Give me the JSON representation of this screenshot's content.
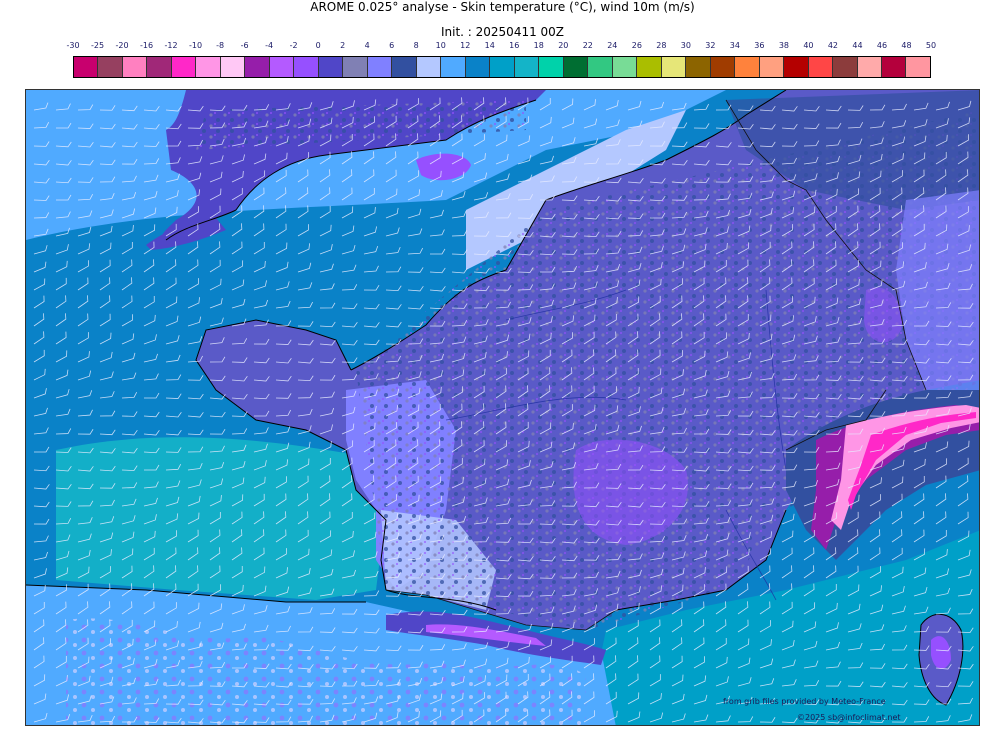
{
  "title": {
    "line1": "AROME 0.025° analyse - Skin temperature (°C), wind 10m (m/s)",
    "line2": "Init. : 20250411 00Z"
  },
  "scale": {
    "labels": [
      "-30",
      "-25",
      "-20",
      "-16",
      "-12",
      "-10",
      "-8",
      "-6",
      "-4",
      "-2",
      "0",
      "2",
      "4",
      "6",
      "8",
      "10",
      "12",
      "14",
      "16",
      "18",
      "20",
      "22",
      "24",
      "26",
      "28",
      "30",
      "32",
      "34",
      "36",
      "38",
      "40",
      "42",
      "44",
      "46",
      "48",
      "50"
    ],
    "colors": [
      "#c8006e",
      "#964060",
      "#ff80c0",
      "#a02878",
      "#ff28c8",
      "#ff96e6",
      "#ffc8f5",
      "#961eaa",
      "#b45aff",
      "#9650ff",
      "#5046c8",
      "#8080b4",
      "#8080ff",
      "#3250a0",
      "#b4c8ff",
      "#50aaff",
      "#0a82c8",
      "#00a0c8",
      "#14b4c8",
      "#00d2aa",
      "#006e32",
      "#32c882",
      "#78dc96",
      "#aabe00",
      "#e6e678",
      "#8c6400",
      "#a03c00",
      "#ff823c",
      "#ffa080",
      "#b40000",
      "#ff4646",
      "#8c3c3c",
      "#ffaaaa",
      "#b4003c",
      "#ff96a0"
    ]
  },
  "map": {
    "sea_color": "#0aa0c8",
    "atlantic_color": "#0a82c8",
    "channel_color": "#50aaff",
    "land_color": "#5a5ac8"
  },
  "credits": {
    "source": "from grib files provided by Meteo-France",
    "copyright": "©2025 sb@infoclimat.net"
  }
}
